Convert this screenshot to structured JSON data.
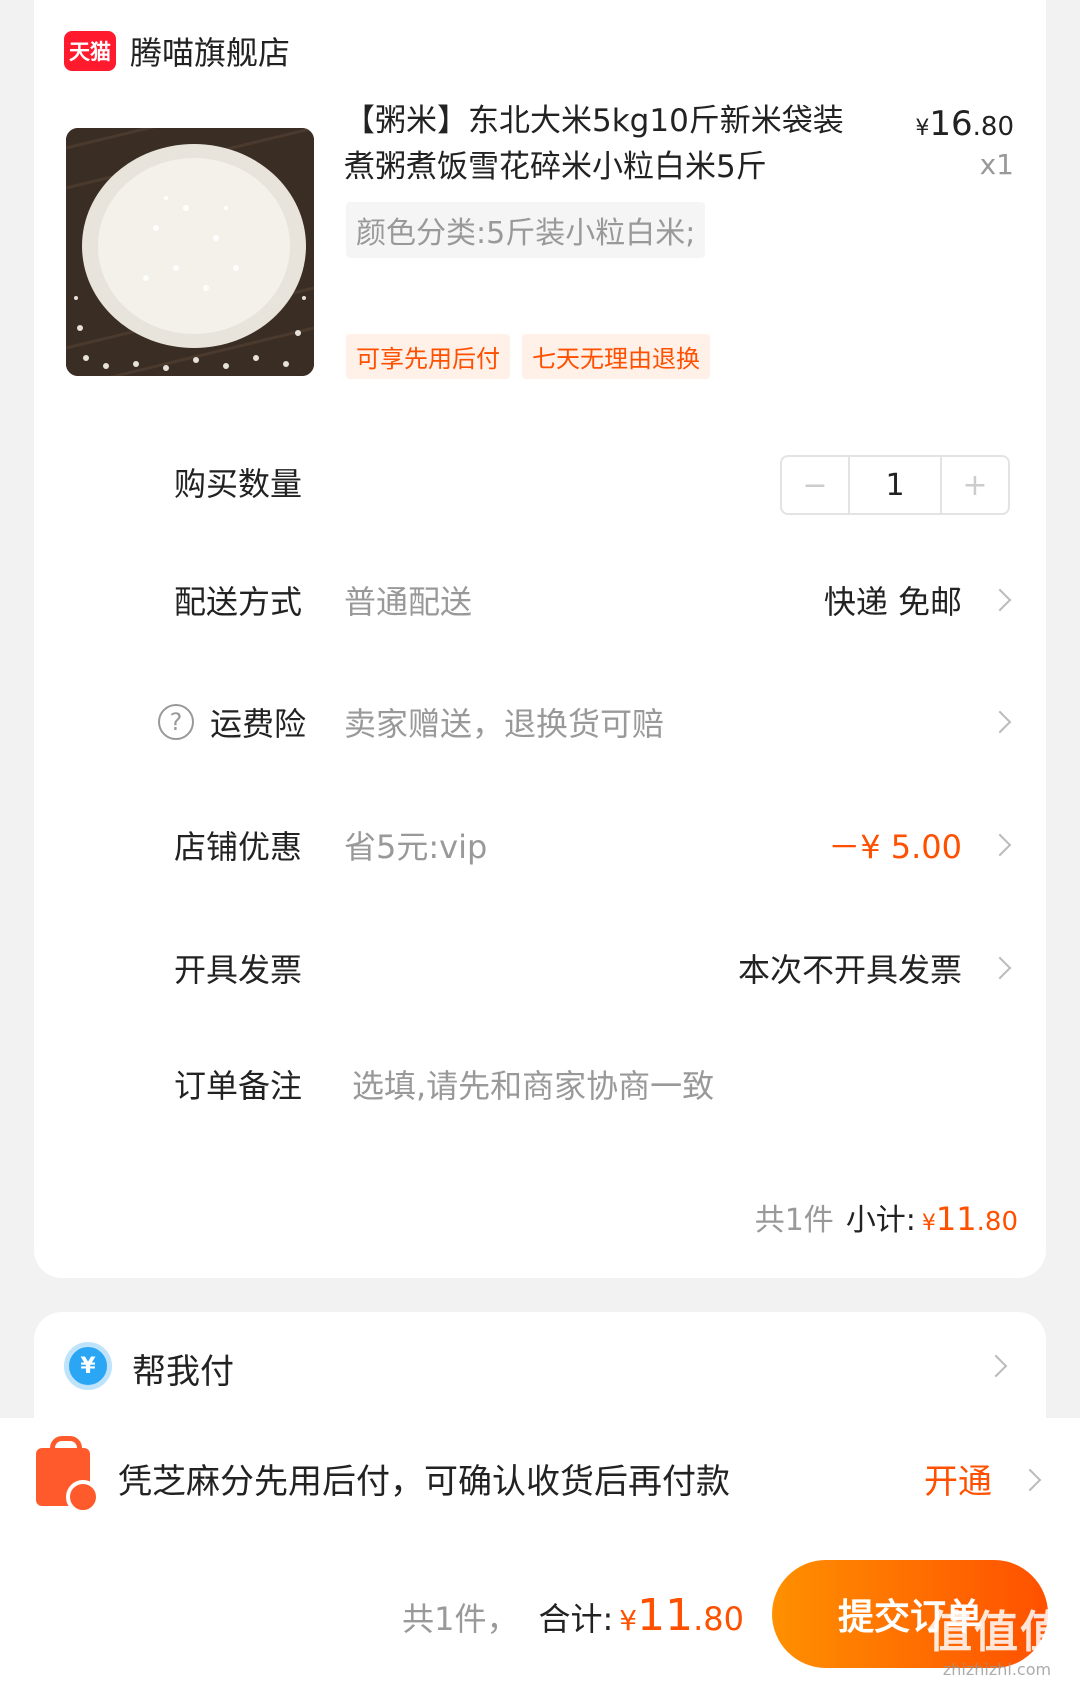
{
  "store": {
    "logo_text": "天猫",
    "name": "腾喵旗舰店",
    "brand_color": "#ff1a2e"
  },
  "product": {
    "title": "【粥米】东北大米5kg10斤新米袋装煮粥煮饭雪花碎米小粒白米5斤",
    "price_currency": "¥",
    "price_int": "16",
    "price_dec": ".80",
    "qty_label": "x1",
    "sku": "颜色分类:5斤装小粒白米;",
    "tags": [
      "可享先用后付",
      "七天无理由退换"
    ]
  },
  "quantity": {
    "label": "购买数量",
    "minus": "−",
    "value": "1",
    "plus": "+"
  },
  "delivery": {
    "label": "配送方式",
    "sub": "普通配送",
    "value": "快递 免邮"
  },
  "insurance": {
    "label": "运费险",
    "sub": "卖家赠送，退换货可赔",
    "icon": "help-icon"
  },
  "discount": {
    "label": "店铺优惠",
    "sub": "省5元:vip",
    "value": "－¥ 5.00"
  },
  "invoice": {
    "label": "开具发票",
    "value": "本次不开具发票"
  },
  "note": {
    "label": "订单备注",
    "placeholder": "选填,请先和商家协商一致"
  },
  "subtotal": {
    "count": "共1件",
    "label": "小计:",
    "currency": "¥",
    "int": "11",
    "dec": ".80"
  },
  "help_pay": {
    "label": "帮我付",
    "icon_text": "¥"
  },
  "credit": {
    "text": "凭芝麻分先用后付，可确认收货后再付款",
    "action": "开通"
  },
  "total": {
    "count": "共1件，",
    "label": "合计:",
    "currency": "¥",
    "int": "11",
    "dec": ".80"
  },
  "submit": {
    "label": "提交订单"
  },
  "watermark": {
    "big": "值值值",
    "small": "zhizhizhi.com"
  },
  "colors": {
    "accent": "#ff5000",
    "accent_gradient_start": "#ff9000"
  }
}
